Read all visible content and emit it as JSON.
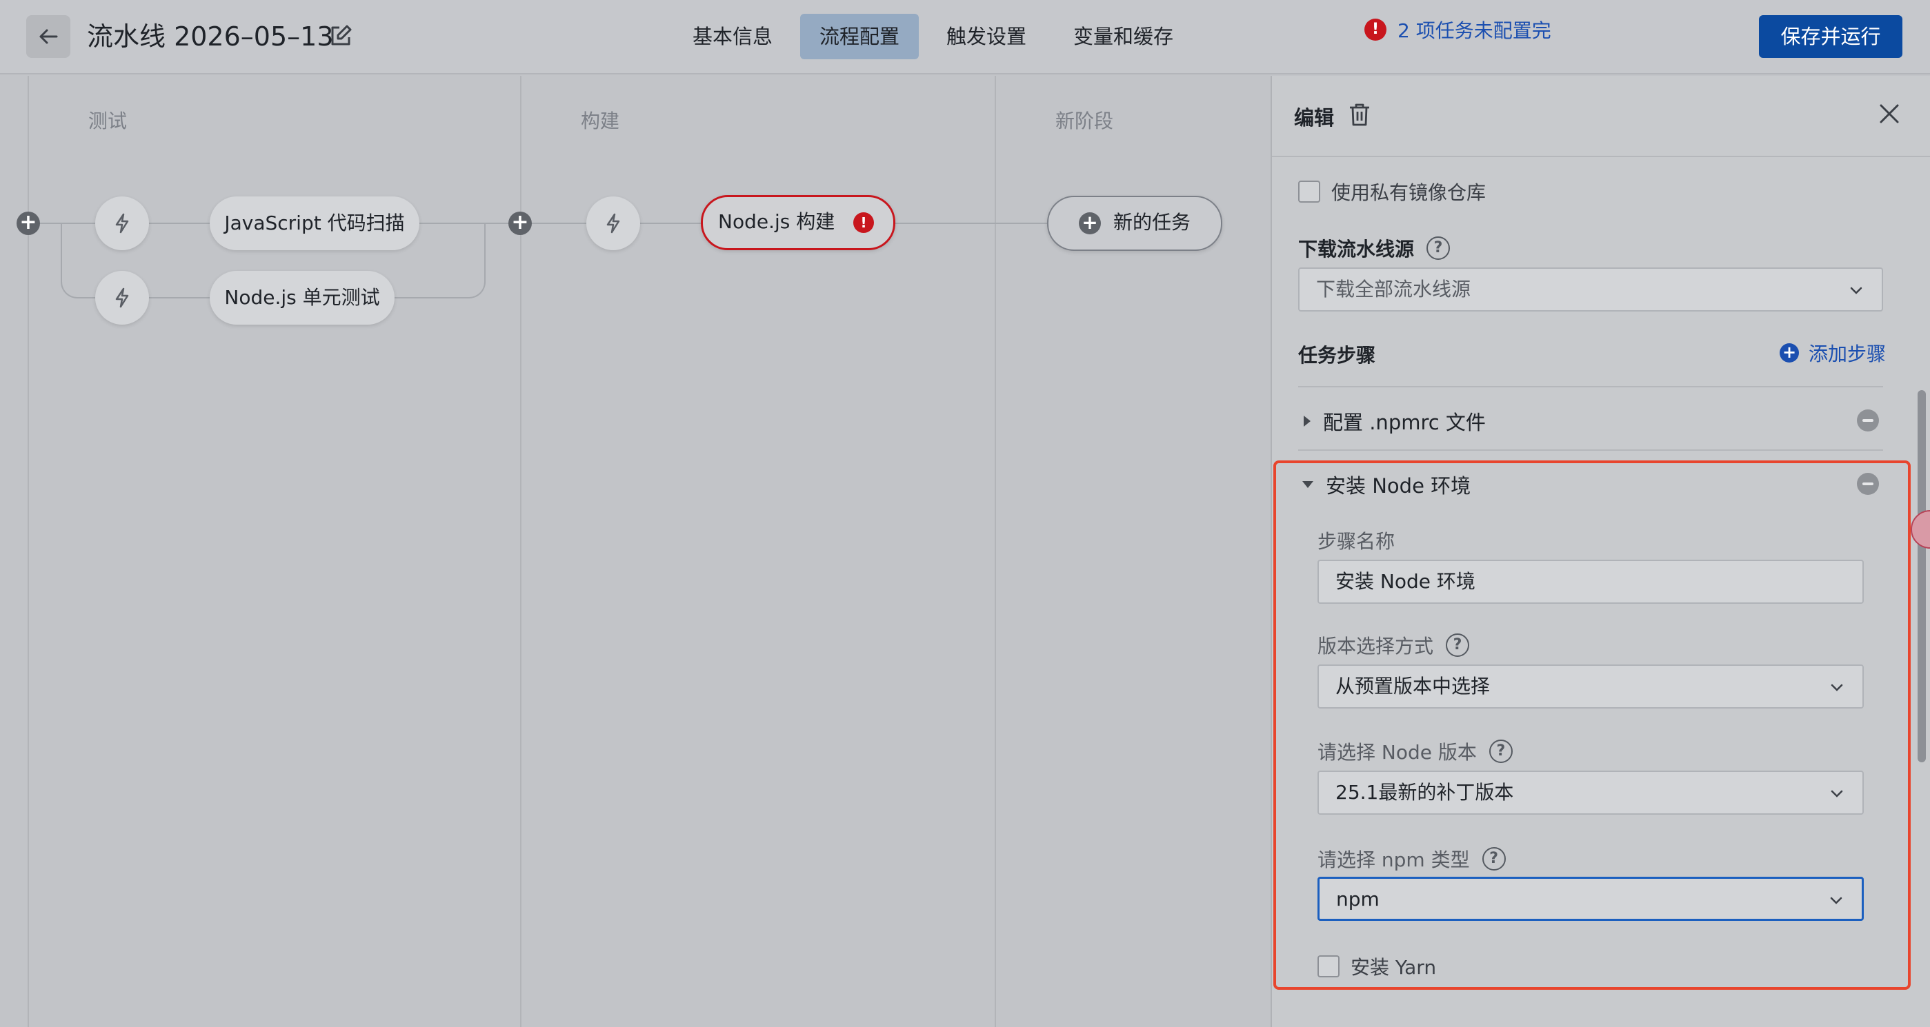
{
  "header": {
    "title": "流水线 2026–05–13",
    "tabs": [
      {
        "label": "基本信息",
        "active": false
      },
      {
        "label": "流程配置",
        "active": true
      },
      {
        "label": "触发设置",
        "active": false
      },
      {
        "label": "变量和缓存",
        "active": false
      }
    ],
    "warning_text": "2 项任务未配置完",
    "primary_button": "保存并运行"
  },
  "canvas": {
    "stages": [
      {
        "title": "测试",
        "jobs": [
          "JavaScript 代码扫描",
          "Node.js 单元测试"
        ]
      },
      {
        "title": "构建",
        "jobs": [
          "Node.js 构建"
        ]
      },
      {
        "title": "新阶段",
        "jobs": [
          "新的任务"
        ]
      }
    ]
  },
  "panel": {
    "title": "编辑",
    "private_registry_label": "使用私有镜像仓库",
    "download_source_label": "下载流水线源",
    "download_source_value": "下载全部流水线源",
    "steps_label": "任务步骤",
    "add_step_label": "添加步骤",
    "steps": [
      {
        "name": "配置 .npmrc 文件",
        "expanded": false
      },
      {
        "name": "安装 Node 环境",
        "expanded": true
      }
    ],
    "step_form": {
      "name_label": "步骤名称",
      "name_value": "安装 Node 环境",
      "version_mode_label": "版本选择方式",
      "version_mode_value": "从预置版本中选择",
      "node_version_label": "请选择 Node 版本",
      "node_version_value": "25.1最新的补丁版本",
      "npm_type_label": "请选择 npm 类型",
      "npm_type_value": "npm",
      "install_yarn_label": "安装 Yarn"
    }
  },
  "colors": {
    "primary": "#0b4aa0",
    "link": "#1b4fb0",
    "error": "#c8161d",
    "highlight_border": "#e8452d"
  }
}
